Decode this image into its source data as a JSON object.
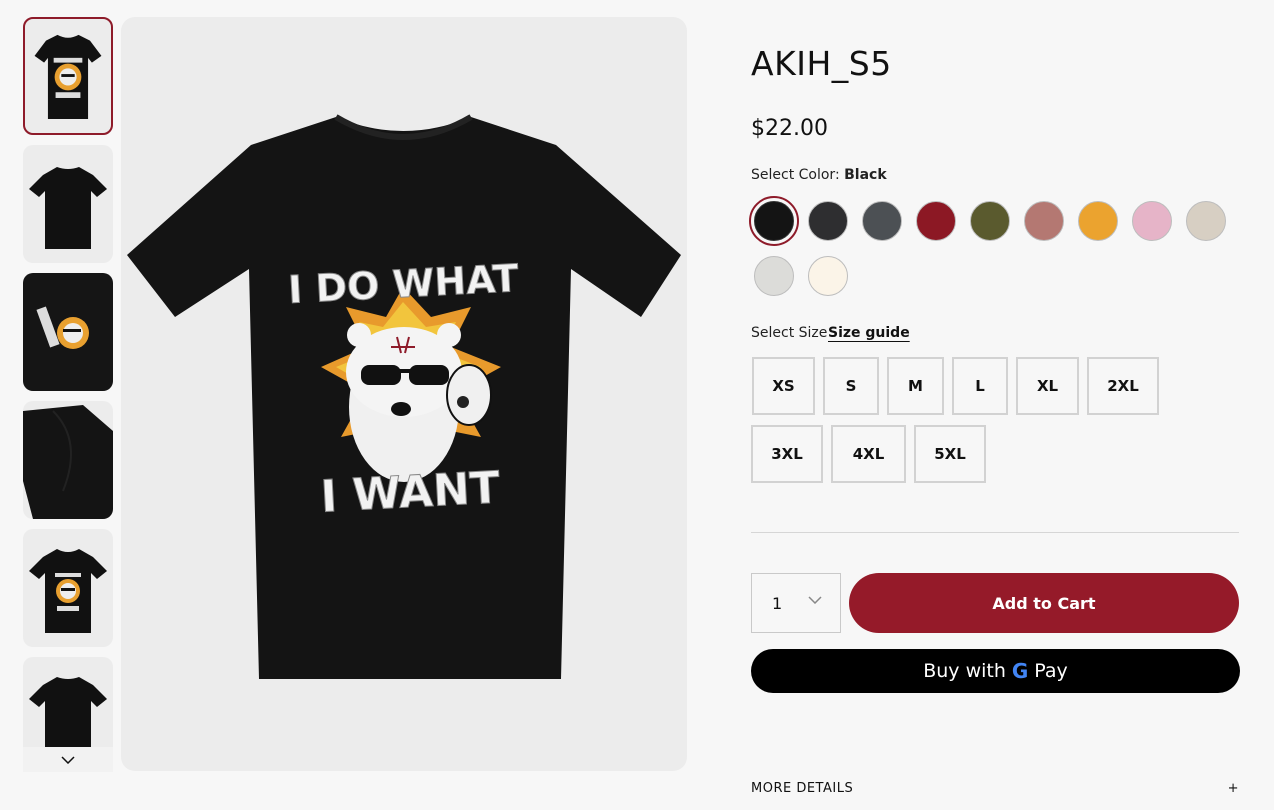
{
  "product": {
    "title": "AKIH_S5",
    "price": "$22.00"
  },
  "color": {
    "label": "Select Color:",
    "selected": "Black",
    "swatches": [
      {
        "name": "Black",
        "hex": "#141414"
      },
      {
        "name": "Dark Heather",
        "hex": "#2e2e30"
      },
      {
        "name": "Charcoal",
        "hex": "#4c5054"
      },
      {
        "name": "Maroon",
        "hex": "#8c1824"
      },
      {
        "name": "Olive",
        "hex": "#5a5a2e"
      },
      {
        "name": "Mauve",
        "hex": "#b47872"
      },
      {
        "name": "Gold",
        "hex": "#eba32f"
      },
      {
        "name": "Pink",
        "hex": "#e6b4c8"
      },
      {
        "name": "Sand",
        "hex": "#d7cfc3"
      },
      {
        "name": "Ash",
        "hex": "#dcdcd9"
      },
      {
        "name": "Cream",
        "hex": "#fbf4e8"
      }
    ]
  },
  "size": {
    "label": "Select Size",
    "guide_link": "Size guide",
    "options": [
      "XS",
      "S",
      "M",
      "L",
      "XL",
      "2XL",
      "3XL",
      "4XL",
      "5XL"
    ]
  },
  "quantity": {
    "value": "1"
  },
  "buttons": {
    "add_to_cart": "Add to Cart",
    "buy_with": "Buy with",
    "gpay_g": "G",
    "gpay_pay": "Pay"
  },
  "details": {
    "label": "MORE DETAILS",
    "toggle": "+"
  },
  "artwork": {
    "line1": "I DO WHAT",
    "line2": "I WANT"
  },
  "thumbnails": [
    "front-design",
    "back-plain",
    "folded-design",
    "sleeve-detail",
    "front-design-small",
    "back-plain-2"
  ],
  "accent_color": "#951a29"
}
